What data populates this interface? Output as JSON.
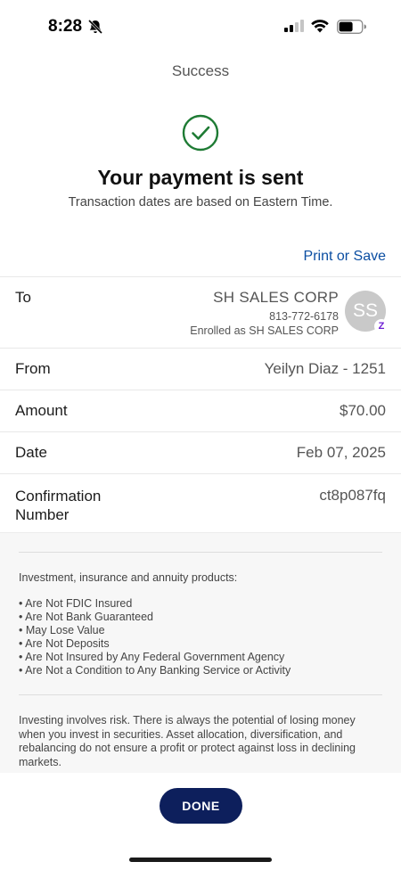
{
  "status_bar": {
    "time": "8:28"
  },
  "nav": {
    "title": "Success"
  },
  "header": {
    "headline": "Your payment is sent",
    "subhead": "Transaction dates are based on Eastern Time."
  },
  "actions": {
    "print_label": "Print or Save",
    "done_label": "DONE"
  },
  "details": {
    "to": {
      "label": "To",
      "name": "SH SALES CORP",
      "phone": "813-772-6178",
      "enrolled": "Enrolled as SH SALES CORP",
      "avatar_initials": "SS",
      "badge": "Z"
    },
    "from": {
      "label": "From",
      "value": "Yeilyn Diaz - 1251"
    },
    "amount": {
      "label": "Amount",
      "value": "$70.00"
    },
    "date": {
      "label": "Date",
      "value": "Feb 07, 2025"
    },
    "confirmation": {
      "label_line1": "Confirmation",
      "label_line2": "Number",
      "value": "ct8p087fq"
    }
  },
  "disclosure": {
    "heading": "Investment, insurance and annuity products:",
    "items": [
      "• Are Not FDIC Insured",
      "• Are Not Bank Guaranteed",
      "• May Lose Value",
      "• Are Not Deposits",
      "• Are Not Insured by Any Federal Government Agency",
      "• Are Not a Condition to Any Banking Service or Activity"
    ],
    "risk_text": "Investing involves risk. There is always the potential of losing money when you invest in securities. Asset allocation, diversification, and rebalancing do not ensure a profit or protect against loss in declining markets."
  },
  "colors": {
    "link": "#0b4ea2",
    "success_green": "#1e7b34",
    "button_navy": "#0d1f5c",
    "zelle_purple": "#6d1ed4"
  }
}
